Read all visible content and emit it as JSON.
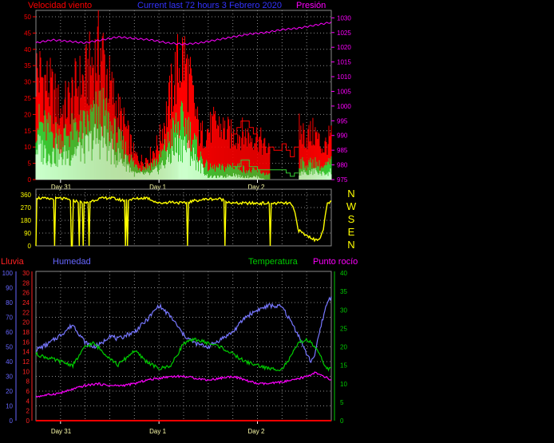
{
  "colors": {
    "grid": "#8a8a8a",
    "wind_gust": "#ff0000",
    "wind_avg": "#33cc33",
    "wind_min": "#ccffcc",
    "pressure": "#ff00ff",
    "direction": "#ffff00",
    "rain": "#ff0000",
    "humidity": "#7777ff",
    "temperature": "#00cc00",
    "dewpoint": "#ff00ff",
    "rain_axis": "#ff2222",
    "hum_axis": "#6666ff",
    "temp_axis": "#00cc00"
  },
  "top": {
    "title": "Current last 72 hours 3 Febrero 2020",
    "label_left": "Velocidad viento",
    "label_right": "Presión",
    "y_left_ticks": [
      "0",
      "5",
      "10",
      "15",
      "20",
      "25",
      "30",
      "35",
      "40",
      "45",
      "50"
    ],
    "y_right_ticks": [
      "975",
      "980",
      "985",
      "990",
      "995",
      "1000",
      "1005",
      "1010",
      "1015",
      "1020",
      "1025",
      "1030"
    ],
    "x_labels": [
      "Day 31",
      "Day 1",
      "Day 2"
    ]
  },
  "mid": {
    "y_ticks": [
      "0",
      "90",
      "180",
      "270",
      "360"
    ],
    "compass": [
      "N",
      "W",
      "S",
      "E",
      "N"
    ]
  },
  "bottom": {
    "label_rain": "Lluvia",
    "label_hum": "Humedad",
    "label_temp": "Temperatura",
    "label_dew": "Punto rocío",
    "rain_ticks": [
      "0",
      "2",
      "4",
      "6",
      "8",
      "10",
      "12",
      "14",
      "16",
      "18",
      "20",
      "22",
      "24",
      "26",
      "28",
      "30"
    ],
    "hum_ticks": [
      "0",
      "10",
      "20",
      "30",
      "40",
      "50",
      "60",
      "70",
      "80",
      "90",
      "100"
    ],
    "temp_ticks": [
      "0",
      "5",
      "10",
      "15",
      "20",
      "25",
      "30",
      "35",
      "40"
    ],
    "x_labels": [
      "Day 31",
      "Day 1",
      "Day 2"
    ]
  },
  "chart_data": [
    {
      "type": "line",
      "x_unit": "hours",
      "xlim": [
        0,
        72
      ],
      "x_tick_labels": [
        "Day 31",
        "Day 1",
        "Day 2"
      ],
      "ylim_left": [
        0,
        50
      ],
      "ylim_right": [
        975,
        1032
      ],
      "series": [
        {
          "axis": "left",
          "x": [
            0,
            2,
            4,
            6,
            8,
            10,
            12,
            14,
            16,
            18,
            20,
            22,
            24,
            26,
            28,
            30,
            32,
            34,
            36,
            38,
            40,
            42,
            44,
            46,
            48,
            50,
            52,
            54,
            56,
            58,
            60,
            62,
            64,
            66,
            68,
            70,
            72
          ],
          "values": [
            35,
            32,
            28,
            22,
            25,
            30,
            32,
            38,
            42,
            30,
            22,
            16,
            8,
            6,
            8,
            12,
            22,
            34,
            40,
            28,
            14,
            16,
            18,
            16,
            14,
            15,
            14,
            14,
            10,
            8,
            6,
            14,
            16,
            14,
            15,
            10,
            14
          ]
        },
        {
          "axis": "left",
          "x": [
            0,
            2,
            4,
            6,
            8,
            10,
            12,
            14,
            16,
            18,
            20,
            22,
            24,
            26,
            28,
            30,
            32,
            34,
            36,
            38,
            40,
            42,
            44,
            46,
            48,
            50,
            52,
            54,
            56,
            58,
            60,
            62,
            64,
            66,
            68,
            70,
            72
          ],
          "values": [
            20,
            18,
            16,
            14,
            16,
            18,
            18,
            22,
            24,
            18,
            14,
            10,
            5,
            4,
            5,
            7,
            12,
            18,
            20,
            15,
            8,
            4,
            4,
            4,
            5,
            4,
            3,
            3,
            2,
            1,
            1,
            4,
            6,
            5,
            6,
            4,
            6
          ]
        },
        {
          "axis": "left",
          "x": [
            0,
            2,
            4,
            6,
            8,
            10,
            12,
            14,
            16,
            18,
            20,
            22,
            24,
            26,
            28,
            30,
            32,
            34,
            36,
            38,
            40,
            42,
            44,
            46,
            48,
            50,
            52,
            54,
            56,
            58,
            60,
            62,
            64,
            66,
            68,
            70,
            72
          ],
          "values": [
            12,
            10,
            9,
            8,
            9,
            11,
            11,
            14,
            15,
            11,
            8,
            6,
            2,
            2,
            2,
            4,
            7,
            11,
            13,
            9,
            5,
            1,
            1,
            1,
            2,
            1,
            1,
            1,
            0,
            0,
            0,
            2,
            3,
            2,
            3,
            2,
            3
          ]
        },
        {
          "axis": "right",
          "x": [
            0,
            4,
            8,
            12,
            16,
            20,
            24,
            28,
            32,
            36,
            40,
            44,
            48,
            52,
            56,
            60,
            64,
            68,
            72
          ],
          "values": [
            1021.5,
            1022.5,
            1022.0,
            1021.5,
            1022.5,
            1023.5,
            1023.0,
            1022.5,
            1021.5,
            1021.0,
            1021.5,
            1022.5,
            1023.5,
            1024.5,
            1025.0,
            1026.0,
            1026.5,
            1027.5,
            1028.5
          ]
        }
      ]
    },
    {
      "type": "line",
      "x_unit": "hours",
      "xlim": [
        0,
        72
      ],
      "ylim": [
        0,
        360
      ],
      "series": [
        {
          "x": [
            0,
            3,
            6,
            9,
            12,
            15,
            18,
            21,
            24,
            27,
            30,
            33,
            36,
            39,
            42,
            45,
            48,
            51,
            54,
            57,
            60,
            62,
            63,
            64,
            65,
            66,
            67,
            68,
            69,
            70,
            71,
            72
          ],
          "values": [
            340,
            330,
            335,
            320,
            300,
            330,
            340,
            320,
            330,
            340,
            300,
            310,
            300,
            320,
            330,
            330,
            300,
            300,
            300,
            300,
            300,
            300,
            250,
            110,
            90,
            70,
            60,
            40,
            50,
            100,
            300,
            310
          ]
        }
      ]
    },
    {
      "type": "line",
      "x_unit": "hours",
      "xlim": [
        0,
        72
      ],
      "ylim_rain": [
        0,
        30
      ],
      "ylim_humidity": [
        0,
        100
      ],
      "ylim_temperature": [
        0,
        40
      ],
      "series": [
        {
          "axis": "rain",
          "x": [
            0,
            72
          ],
          "values": [
            0,
            0
          ]
        },
        {
          "axis": "humidity",
          "x": [
            0,
            3,
            6,
            9,
            12,
            14,
            16,
            18,
            20,
            22,
            24,
            27,
            30,
            33,
            36,
            39,
            42,
            45,
            48,
            51,
            54,
            57,
            60,
            62,
            64,
            66,
            67,
            68,
            69,
            70,
            71,
            72
          ],
          "values": [
            48,
            52,
            58,
            65,
            53,
            50,
            52,
            58,
            55,
            58,
            60,
            68,
            78,
            70,
            58,
            52,
            50,
            55,
            60,
            70,
            75,
            78,
            77,
            68,
            58,
            45,
            40,
            45,
            58,
            70,
            80,
            84
          ]
        },
        {
          "axis": "temperature",
          "x": [
            0,
            3,
            6,
            9,
            12,
            14,
            16,
            18,
            20,
            22,
            24,
            27,
            30,
            33,
            36,
            39,
            42,
            45,
            48,
            51,
            54,
            57,
            60,
            62,
            64,
            66,
            67,
            68,
            69,
            70,
            71,
            72
          ],
          "values": [
            18,
            17,
            16,
            15,
            20,
            21,
            19,
            17,
            15,
            17,
            19,
            16,
            14,
            15,
            21,
            22,
            21,
            20,
            18,
            16,
            15,
            14,
            14,
            17,
            21,
            22,
            21,
            20,
            18,
            16,
            14,
            14
          ]
        },
        {
          "axis": "temperature",
          "x": [
            0,
            3,
            6,
            9,
            12,
            15,
            18,
            21,
            24,
            27,
            30,
            33,
            36,
            39,
            42,
            45,
            48,
            51,
            54,
            57,
            60,
            63,
            66,
            68,
            70,
            72
          ],
          "values": [
            6.5,
            7,
            7.5,
            8.5,
            9.5,
            10,
            9.5,
            9.5,
            10,
            11,
            11.5,
            12,
            12,
            11.5,
            11,
            11.5,
            12,
            11,
            10,
            10,
            10.5,
            11,
            12,
            13,
            12,
            11
          ]
        }
      ]
    }
  ]
}
